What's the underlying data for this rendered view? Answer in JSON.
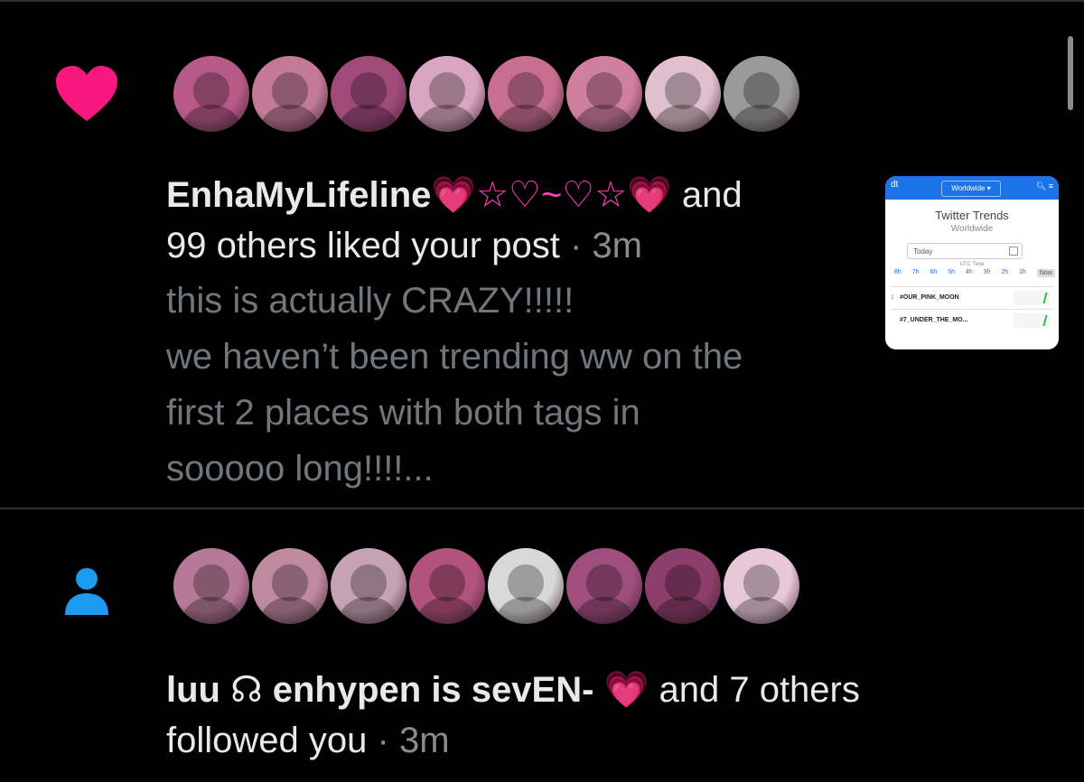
{
  "theme": {
    "background": "#000000",
    "text": "#e7e9ea",
    "muted": "#71767b",
    "like_pink": "#f91880",
    "follow_blue": "#1d9bf0",
    "divider": "#2f3336"
  },
  "notifications": [
    {
      "type": "like",
      "icon": "heart-icon",
      "avatar_colors": [
        "#b85a88",
        "#c27a98",
        "#a04a7a",
        "#d9a6c2",
        "#c86f8f",
        "#d07fa0",
        "#e0c0cc",
        "#9a9a9a"
      ],
      "name": "EnhaMyLifeline",
      "name_decor": "💗☆♡~♡☆💗",
      "and_text": "and",
      "action_text": "99 others liked your post",
      "separator": "·",
      "time": "3m",
      "preview_lines": [
        "this is actually CRAZY!!!!!",
        "we haven’t been trending ww on the",
        "first 2 places with both tags in",
        "sooooo long!!!!..."
      ],
      "thumbnail": {
        "corner_label": "dt",
        "dropdown": "Worldwide ▾",
        "icons": "🔍︎ ≡",
        "title": "Twitter Trends",
        "subtitle": "Worldwide",
        "date_label": "Today",
        "utc_label": "UTC Time",
        "hours": [
          "8h",
          "7h",
          "6h",
          "5h",
          "4h",
          "3h",
          "2h",
          "1h",
          "Now"
        ],
        "rows": [
          {
            "rank": "1",
            "tag": "#OUR_PINK_MOON"
          },
          {
            "rank": "",
            "tag": "#7_UNDER_THE_MO..."
          }
        ]
      }
    },
    {
      "type": "follow",
      "icon": "person-icon",
      "avatar_colors": [
        "#b67a98",
        "#c08a9e",
        "#c6a3b2",
        "#b2537e",
        "#d8d8d8",
        "#a04e7e",
        "#8e3e6a",
        "#e8c8d8"
      ],
      "name": "luu ☊ enhypen is sevEN-",
      "name_decor": "💗",
      "and_text": "and 7 others",
      "action_text": "followed you",
      "separator": "·",
      "time": "3m"
    }
  ]
}
